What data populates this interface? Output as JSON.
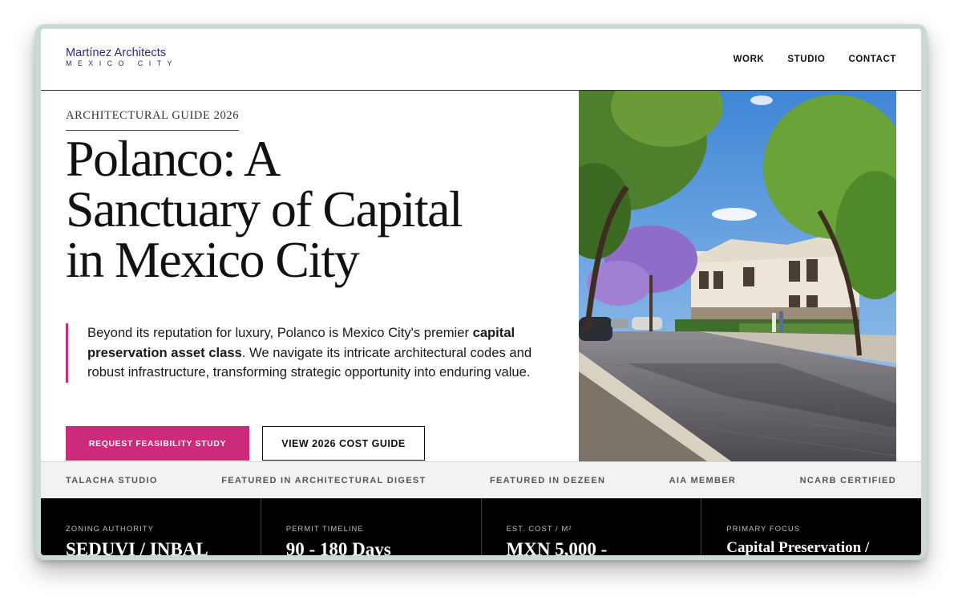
{
  "brand": {
    "name": "Martínez Architects",
    "location": "MEXICO CITY"
  },
  "nav": {
    "work": "WORK",
    "studio": "STUDIO",
    "contact": "CONTACT"
  },
  "hero": {
    "eyebrow": "ARCHITECTURAL GUIDE 2026",
    "headline_line1": "Polanco: A",
    "headline_line2": "Sanctuary of Capital",
    "headline_line3": "in Mexico City",
    "lede_part1": "Beyond its reputation for luxury, Polanco is Mexico City's premier ",
    "lede_bold": "capital preservation asset class",
    "lede_part2": ". We navigate its intricate architectural codes and robust infrastructure, transforming strategic opportunity into enduring value.",
    "primary_cta": "REQUEST FEASIBILITY STUDY",
    "secondary_cta": "VIEW 2026 COST GUIDE"
  },
  "trust_bar": [
    "TALACHA STUDIO",
    "FEATURED IN ARCHITECTURAL DIGEST",
    "FEATURED IN DEZEEN",
    "AIA MEMBER",
    "NCARB CERTIFIED"
  ],
  "stats": [
    {
      "label": "ZONING AUTHORITY",
      "value": "SEDUVI / INBAL"
    },
    {
      "label": "PERMIT TIMELINE",
      "value": "90 - 180 Days"
    },
    {
      "label": "EST. COST / M²",
      "value": "MXN 5,000 -"
    },
    {
      "label": "PRIMARY FOCUS",
      "value": "Capital Preservation /"
    }
  ],
  "colors": {
    "accent": "#cc2b7b",
    "brand": "#2b2b7a",
    "stats_bg": "#000000"
  }
}
